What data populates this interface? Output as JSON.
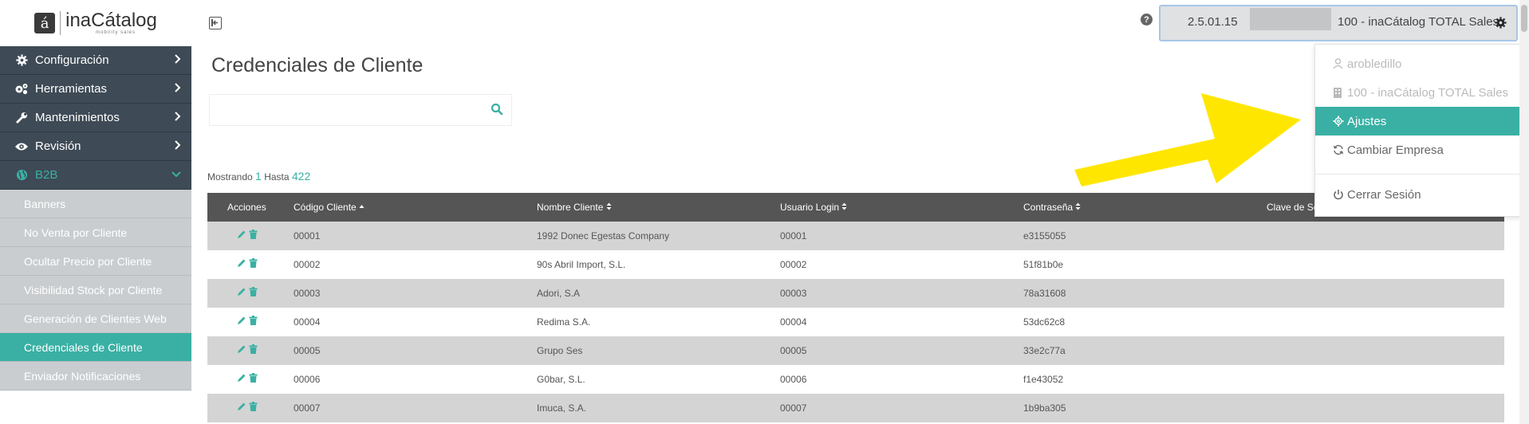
{
  "logo": {
    "glyph": "á",
    "name": "inaCátalog",
    "sub": "mobility sales"
  },
  "sidebar": {
    "items": [
      {
        "label": "Configuración",
        "icon": "gear-icon"
      },
      {
        "label": "Herramientas",
        "icon": "gears-icon"
      },
      {
        "label": "Mantenimientos",
        "icon": "wrench-icon"
      },
      {
        "label": "Revisión",
        "icon": "eye-icon"
      },
      {
        "label": "B2B",
        "icon": "globe-icon"
      }
    ],
    "subitems": [
      "Banners",
      "No Venta por Cliente",
      "Ocultar Precio por Cliente",
      "Visibilidad Stock por Cliente",
      "Generación de Clientes Web",
      "Credenciales de Cliente",
      "Enviador Notificaciones"
    ],
    "active_subitem": "Credenciales de Cliente"
  },
  "page": {
    "title": "Credenciales de Cliente",
    "search_placeholder": ""
  },
  "showing": {
    "prefix": "Mostrando",
    "from": "1",
    "mid": "Hasta",
    "to": "422"
  },
  "table": {
    "headers": [
      "Acciones",
      "Código Cliente",
      "Nombre Cliente",
      "Usuario Login",
      "Contraseña",
      "Clave de Se"
    ],
    "rows": [
      [
        "00001",
        "1992 Donec Egestas Company",
        "00001",
        "e3155055"
      ],
      [
        "00002",
        "90s Abril Import, S.L.",
        "00002",
        "51f81b0e"
      ],
      [
        "00003",
        "Adori, S.A",
        "00003",
        "78a31608"
      ],
      [
        "00004",
        "Redima S.A.",
        "00004",
        "53dc62c8"
      ],
      [
        "00005",
        "Grupo Ses",
        "00005",
        "33e2c77a"
      ],
      [
        "00006",
        "G0bar, S.L.",
        "00006",
        "f1e43052"
      ],
      [
        "00007",
        "Imuca, S.A.",
        "00007",
        "1b9ba305"
      ]
    ]
  },
  "topbar": {
    "version": "2.5.01.15",
    "company": "100 - inaCátalog TOTAL Sales",
    "help": "?"
  },
  "dropdown": {
    "user": "arobledillo",
    "company": "100 - inaCátalog TOTAL Sales",
    "settings": "Ajustes",
    "change_company": "Cambiar Empresa",
    "logout": "Cerrar Sesión"
  },
  "colors": {
    "accent": "#3ab0a4",
    "sidebar": "#3e4a55",
    "submenu": "#c9cdd0",
    "table_header": "#555555",
    "arrow": "#ffe600"
  }
}
